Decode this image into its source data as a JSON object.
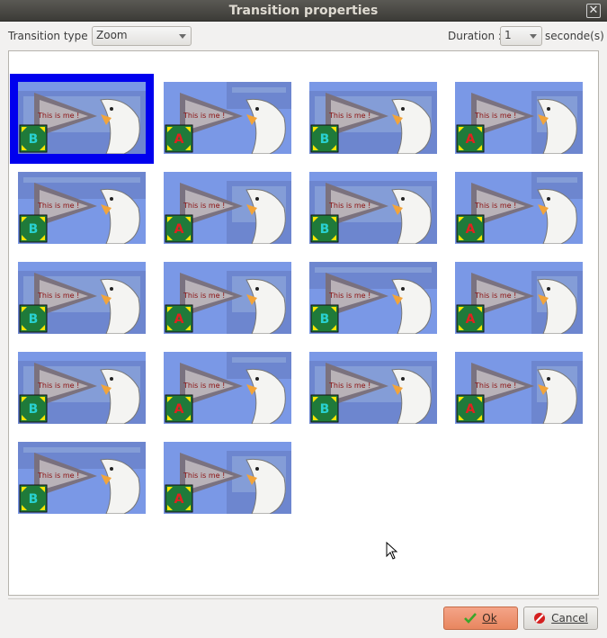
{
  "window": {
    "title": "Transition properties",
    "close_glyph": "✕"
  },
  "toolbar": {
    "transition_type_label": "Transition type :",
    "transition_type_value": "Zoom",
    "duration_label": "Duration :",
    "duration_value": "1",
    "duration_unit": "seconde(s)"
  },
  "thumbnails": {
    "count": 18,
    "selected_index": 0,
    "caption_text": "This is me !",
    "items": [
      {
        "index": 0,
        "badge": "B"
      },
      {
        "index": 1,
        "badge": "A"
      },
      {
        "index": 2,
        "badge": "B"
      },
      {
        "index": 3,
        "badge": "A"
      },
      {
        "index": 4,
        "badge": "B"
      },
      {
        "index": 5,
        "badge": "A"
      },
      {
        "index": 6,
        "badge": "B"
      },
      {
        "index": 7,
        "badge": "A"
      },
      {
        "index": 8,
        "badge": "B"
      },
      {
        "index": 9,
        "badge": "A"
      },
      {
        "index": 10,
        "badge": "B"
      },
      {
        "index": 11,
        "badge": "A"
      },
      {
        "index": 12,
        "badge": "B"
      },
      {
        "index": 13,
        "badge": "A"
      },
      {
        "index": 14,
        "badge": "B"
      },
      {
        "index": 15,
        "badge": "A"
      },
      {
        "index": 16,
        "badge": "B"
      },
      {
        "index": 17,
        "badge": "A"
      }
    ]
  },
  "footer": {
    "ok_label": "Ok",
    "cancel_label": "Cancel",
    "ok_icon": "check-icon",
    "cancel_icon": "cancel-icon"
  },
  "colors": {
    "selection": "#0000ee",
    "ok_button": "#e8865f",
    "sky": "#7a98e6",
    "photo": "#6b84cc",
    "badge_bg": "#1f7a3a",
    "badge_letter_b": "#29d1d1",
    "badge_letter_a": "#e32020",
    "arrow": "#ffe600"
  }
}
